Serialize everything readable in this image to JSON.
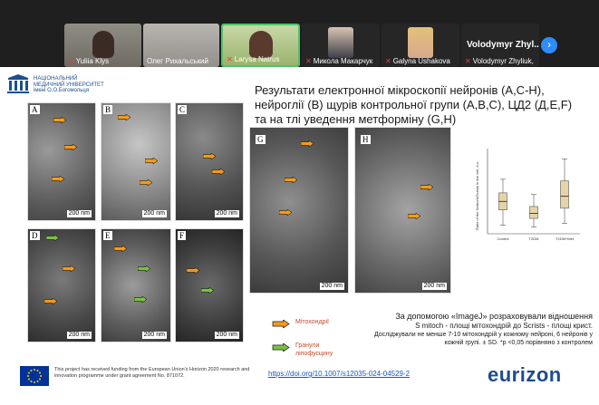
{
  "participants": [
    {
      "name": "Yuliia Klys",
      "muted": true
    },
    {
      "name": "Олег Рихальський",
      "muted": false
    },
    {
      "name": "Larysa Natrus",
      "muted": true,
      "active": true
    },
    {
      "name": "Микола Макарчук",
      "muted": true
    },
    {
      "name": "Galyna Ushakova",
      "muted": true
    },
    {
      "name": "Volodymyr Zhyliuk, N...",
      "muted": true
    }
  ],
  "big_name": "Volodymyr Zhyl...",
  "next_glyph": "›",
  "logo": {
    "line1": "НАЦІОНАЛЬНИЙ",
    "line2": "МЕДИЧНИЙ УНІВЕРСИТЕТ",
    "line3": "імені О.О.Богомольця",
    "mark": "НМУ"
  },
  "title": "Результати електронної мікроскопії нейронів (А,С-Н), нейроглії (В) щурів контрольної групи (А,В,С), ЦД2 (Д,Е,F) та на тлі уведення метформіну (G,H)",
  "panels": [
    {
      "label": "A",
      "scale": "200 nm"
    },
    {
      "label": "B",
      "scale": "200 nm"
    },
    {
      "label": "C",
      "scale": "200 nm"
    },
    {
      "label": "D",
      "scale": "200 nm"
    },
    {
      "label": "E",
      "scale": "200 nm"
    },
    {
      "label": "F",
      "scale": "200 nm"
    },
    {
      "label": "G",
      "scale": "200 nm"
    },
    {
      "label": "H",
      "scale": "200 nm"
    }
  ],
  "legend": {
    "mito": "Мітохондрії",
    "lipo": "Гранули ліпофусцину"
  },
  "caption": {
    "line1": "За допомогою «ImageJ» розраховували відношення",
    "line2": "S mitoch - площі мітохондрій до Scrists - площі крист.",
    "line3": "Досліджували не менше 7-10 мітохондрій у кожному нейроні, 6 нейронів у кожній групі. ± SD. *р <0,05 порівняно з контролем"
  },
  "funding": "This project has received funding from the European Union's Horizon 2020 research and innovation programme under grant agreement No. 871072.",
  "doi": "https://doi.org/10.1007/s12035-024-04529-2",
  "brand": "eurizon",
  "colors": {
    "accent": "#2d8cff",
    "active_border": "#4fc36b",
    "mito_arrow": "#f39a1e",
    "lipo_arrow": "#7ac143",
    "brand": "#1e4c8f"
  },
  "chart_data": {
    "type": "boxplot",
    "ylabel": "Ratio of the Smitoch/Scrists in the cell, a.u.",
    "categories": [
      "Control",
      "T2DM",
      "T2DM+Met"
    ],
    "ylim": [
      0,
      1
    ],
    "boxes": [
      {
        "name": "Control",
        "min": 0.1,
        "q1": 0.28,
        "median": 0.38,
        "q3": 0.48,
        "max": 0.64
      },
      {
        "name": "T2DM",
        "min": 0.08,
        "q1": 0.18,
        "median": 0.24,
        "q3": 0.32,
        "max": 0.46
      },
      {
        "name": "T2DM+Met",
        "min": 0.12,
        "q1": 0.3,
        "median": 0.44,
        "q3": 0.62,
        "max": 0.88
      }
    ]
  }
}
